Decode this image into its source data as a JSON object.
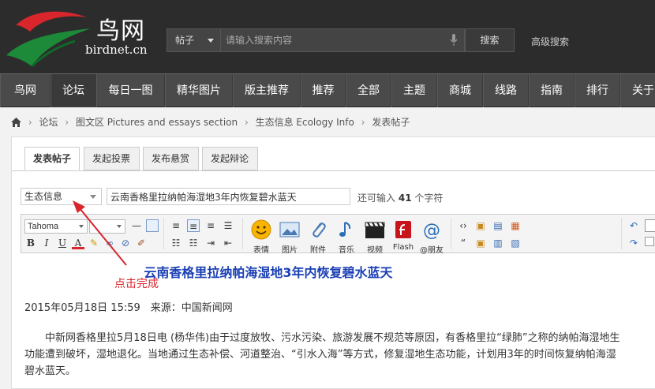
{
  "header": {
    "logo_cn": "鸟网",
    "logo_en": "birdnet.cn",
    "search_type": "帖子",
    "search_placeholder": "请输入搜索内容",
    "search_button": "搜索",
    "advanced_search": "高级搜索"
  },
  "nav": {
    "items": [
      "鸟网",
      "论坛",
      "每日一图",
      "精华图片",
      "版主推荐",
      "推荐",
      "全部",
      "主题",
      "商城",
      "线路",
      "指南",
      "排行",
      "关于"
    ],
    "active_index": 1
  },
  "breadcrumb": {
    "items": [
      "论坛",
      "图文区 Pictures and essays section",
      "生态信息 Ecology Info",
      "发表帖子"
    ]
  },
  "tabs": [
    "发表帖子",
    "发起投票",
    "发布悬赏",
    "发起辩论"
  ],
  "form": {
    "category": "生态信息",
    "title_value": "云南香格里拉纳帕海湿地3年内恢复碧水蓝天",
    "hint_prefix": "还可输入",
    "hint_count": "41",
    "hint_suffix": "个字符"
  },
  "toolbar": {
    "font": "Tahoma",
    "font_size": "",
    "buttons": [
      "表情",
      "图片",
      "附件",
      "音乐",
      "视频",
      "Flash",
      "@朋友"
    ]
  },
  "post": {
    "title": "云南香格里拉纳帕海湿地3年内恢复碧水蓝天",
    "meta": "2015年05月18日 15:59　来源：中国新闻网",
    "line1": "中新网香格里拉5月18日电 (杨华伟)由于过度放牧、污水污染、旅游发展不规范等原因，有香格里拉“绿肺”之称的纳帕海湿地生",
    "line2": "功能遭到破坏，湿地退化。当地通过生态补偿、河道整治、“引水入海”等方式，修复湿地生态功能，计划用3年的时间恢复纳帕海湿",
    "line3": "碧水蓝天。"
  },
  "annotation": {
    "text": "点击完成",
    "color": "#d9262c"
  }
}
